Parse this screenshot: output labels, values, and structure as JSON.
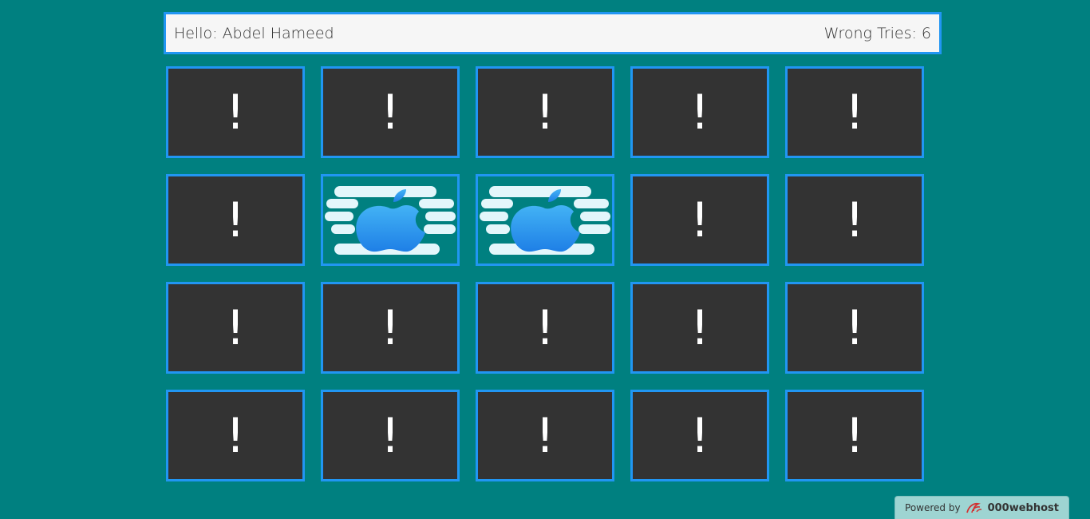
{
  "header": {
    "greeting_label": "Hello:",
    "player_name": "Abdel Hameed",
    "wrong_tries_label": "Wrong Tries:",
    "wrong_tries_value": "6"
  },
  "cards": [
    {
      "label": "!",
      "flipped": false,
      "icon": null
    },
    {
      "label": "!",
      "flipped": false,
      "icon": null
    },
    {
      "label": "!",
      "flipped": false,
      "icon": null
    },
    {
      "label": "!",
      "flipped": false,
      "icon": null
    },
    {
      "label": "!",
      "flipped": false,
      "icon": null
    },
    {
      "label": "!",
      "flipped": false,
      "icon": null
    },
    {
      "label": "!",
      "flipped": true,
      "icon": "apple-logo-icon"
    },
    {
      "label": "!",
      "flipped": true,
      "icon": "apple-logo-icon"
    },
    {
      "label": "!",
      "flipped": false,
      "icon": null
    },
    {
      "label": "!",
      "flipped": false,
      "icon": null
    },
    {
      "label": "!",
      "flipped": false,
      "icon": null
    },
    {
      "label": "!",
      "flipped": false,
      "icon": null
    },
    {
      "label": "!",
      "flipped": false,
      "icon": null
    },
    {
      "label": "!",
      "flipped": false,
      "icon": null
    },
    {
      "label": "!",
      "flipped": false,
      "icon": null
    },
    {
      "label": "!",
      "flipped": false,
      "icon": null
    },
    {
      "label": "!",
      "flipped": false,
      "icon": null
    },
    {
      "label": "!",
      "flipped": false,
      "icon": null
    },
    {
      "label": "!",
      "flipped": false,
      "icon": null
    },
    {
      "label": "!",
      "flipped": false,
      "icon": null
    }
  ],
  "footer": {
    "powered_label": "Powered by",
    "brand_name": "000webhost",
    "brand_icon": "000webhost-logo-icon"
  },
  "colors": {
    "background": "#008080",
    "card_back": "#333333",
    "card_border": "#2196f3",
    "header_bg": "#f6f6f6"
  }
}
